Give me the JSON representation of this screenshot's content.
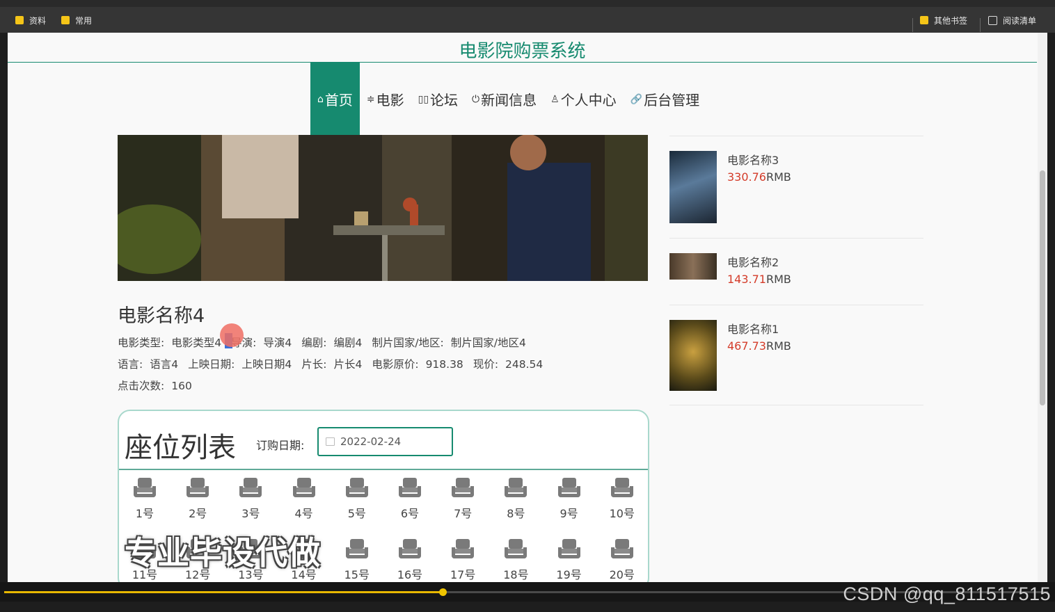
{
  "bookmarks": {
    "left": [
      {
        "label": "资料"
      },
      {
        "label": "常用"
      }
    ],
    "other_bookmarks": "其他书签",
    "reading_list": "阅读清单"
  },
  "site": {
    "title": "电影院购票系统",
    "nav": [
      {
        "icon": "home-icon",
        "glyph": "⌂",
        "label": "首页",
        "active": true
      },
      {
        "icon": "sliders-icon",
        "glyph": "≑",
        "label": "电影",
        "active": false
      },
      {
        "icon": "forum-icon",
        "glyph": "▯▯",
        "label": "论坛",
        "active": false
      },
      {
        "icon": "power-icon",
        "glyph": "⏻",
        "label": "新闻信息",
        "active": false
      },
      {
        "icon": "user-icon",
        "glyph": "♙",
        "label": "个人中心",
        "active": false
      },
      {
        "icon": "link-icon",
        "glyph": "🔗",
        "label": "后台管理",
        "active": false
      }
    ],
    "accent_color": "#168a6f",
    "price_color": "#d43c2a"
  },
  "movie": {
    "name": "电影名称4",
    "row1": [
      {
        "k": "电影类型:",
        "v": "电影类型4"
      },
      {
        "k": "导演:",
        "v": "导演4"
      },
      {
        "k": "编剧:",
        "v": "编剧4"
      },
      {
        "k": "制片国家/地区:",
        "v": "制片国家/地区4"
      }
    ],
    "row2": [
      {
        "k": "语言:",
        "v": "语言4"
      },
      {
        "k": "上映日期:",
        "v": "上映日期4"
      },
      {
        "k": "片长:",
        "v": "片长4"
      },
      {
        "k": "电影原价:",
        "v": "918.38"
      },
      {
        "k": "现价:",
        "v": "248.54"
      }
    ],
    "row3": [
      {
        "k": "点击次数:",
        "v": "160"
      }
    ]
  },
  "seats": {
    "title": "座位列表",
    "date_label": "订购日期:",
    "date_value": "2022-02-24",
    "items": [
      "1号",
      "2号",
      "3号",
      "4号",
      "5号",
      "6号",
      "7号",
      "8号",
      "9号",
      "10号",
      "11号",
      "12号",
      "13号",
      "14号",
      "15号",
      "16号",
      "17号",
      "18号",
      "19号",
      "20号"
    ]
  },
  "sidebar": [
    {
      "name": "电影名称3",
      "price": "330.76",
      "unit": "RMB"
    },
    {
      "name": "电影名称2",
      "price": "143.71",
      "unit": "RMB"
    },
    {
      "name": "电影名称1",
      "price": "467.73",
      "unit": "RMB"
    }
  ],
  "overlay": {
    "watermark": "专业毕设代做",
    "credit": "CSDN @qq_811517515"
  },
  "player": {
    "progress": 0.42
  }
}
